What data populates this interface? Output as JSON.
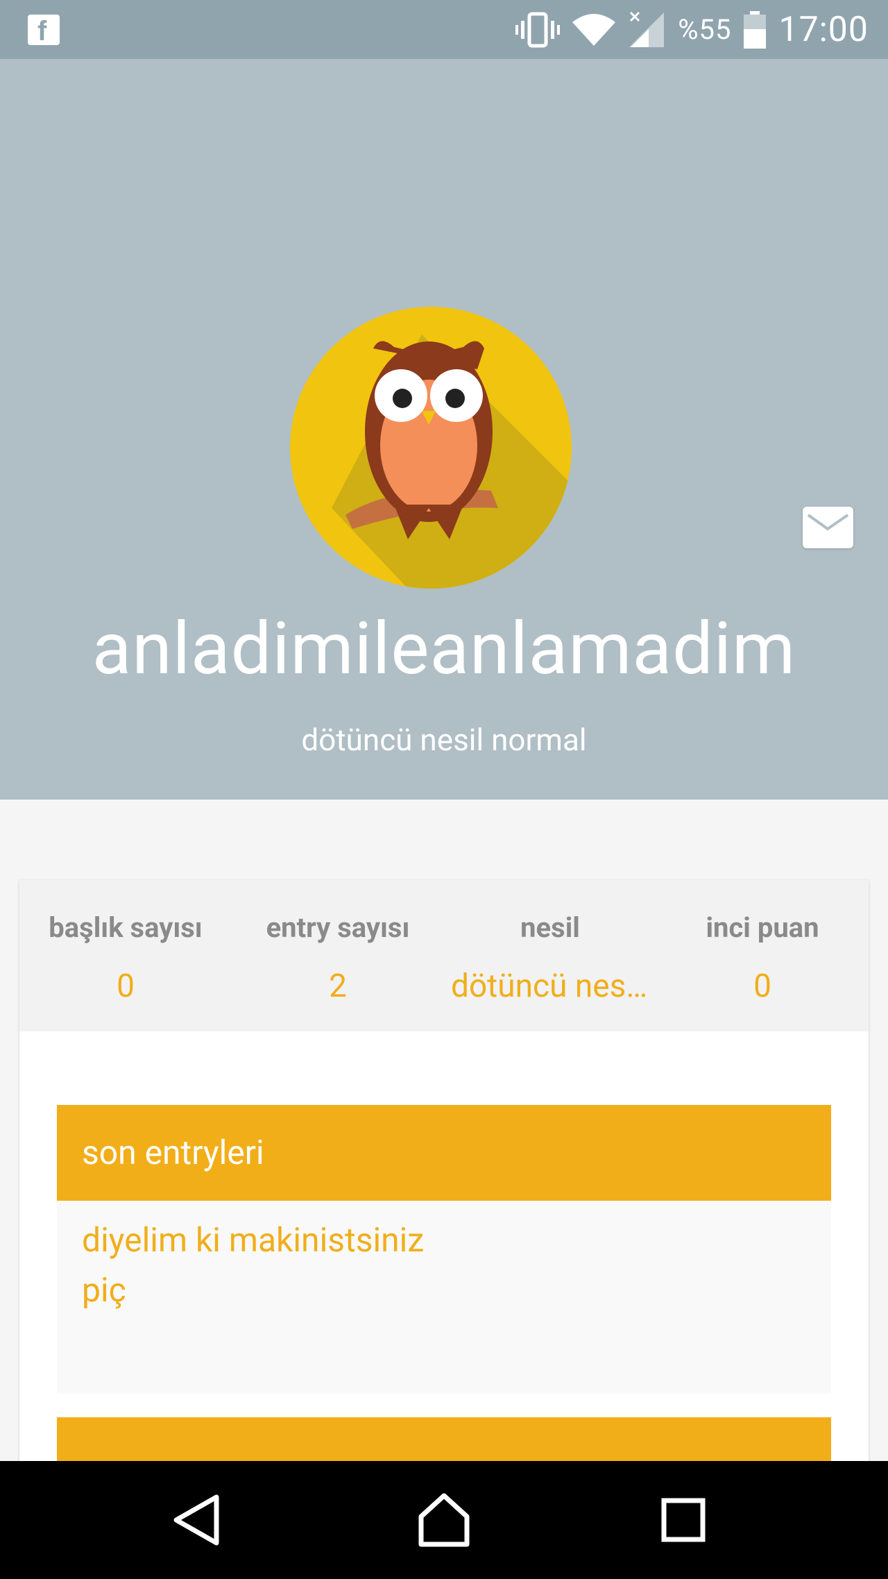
{
  "status_bar": {
    "battery_percent": "%55",
    "time": "17:00",
    "icons": [
      "facebook-icon",
      "vibrate-icon",
      "wifi-icon",
      "signal-icon",
      "battery-icon"
    ]
  },
  "profile": {
    "username": "anladimileanlamadim",
    "subtitle": "dötüncü nesil normal",
    "avatar": "owl-avatar"
  },
  "stats": [
    {
      "label": "başlık sayısı",
      "value": "0"
    },
    {
      "label": "entry sayısı",
      "value": "2"
    },
    {
      "label": "nesil",
      "value": "dötüncü nesi..."
    },
    {
      "label": "inci puan",
      "value": "0"
    }
  ],
  "sections": {
    "recent_entries": {
      "title": "son entryleri",
      "items": [
        "diyelim ki makinistsiniz",
        "piç"
      ]
    }
  },
  "colors": {
    "status_bar": "#90a4ae",
    "header_bg": "#b0bec5",
    "accent": "#f2ae19",
    "stat_value": "#f0ae1b"
  }
}
